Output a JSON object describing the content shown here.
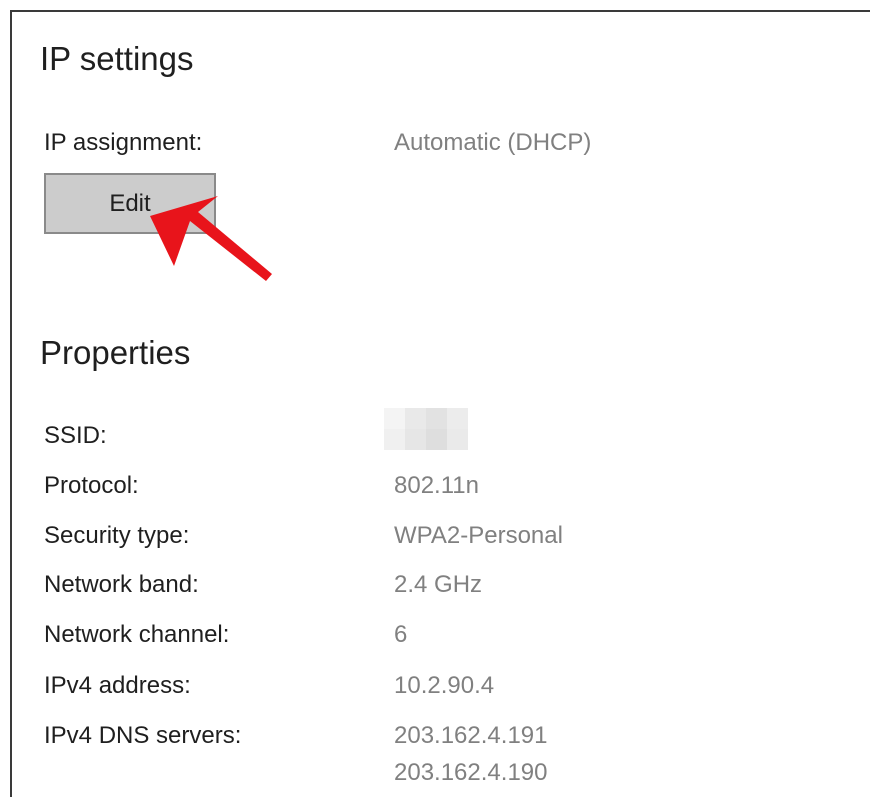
{
  "ip_settings": {
    "title": "IP settings",
    "assignment_label": "IP assignment:",
    "assignment_value": "Automatic (DHCP)",
    "edit_label": "Edit"
  },
  "properties": {
    "title": "Properties",
    "rows": [
      {
        "label": "SSID:",
        "value": ""
      },
      {
        "label": "Protocol:",
        "value": "802.11n"
      },
      {
        "label": "Security type:",
        "value": "WPA2-Personal"
      },
      {
        "label": "Network band:",
        "value": "2.4 GHz"
      },
      {
        "label": "Network channel:",
        "value": "6"
      },
      {
        "label": "IPv4 address:",
        "value": "10.2.90.4"
      },
      {
        "label": "IPv4 DNS servers:",
        "value": "203.162.4.191"
      },
      {
        "label": "",
        "value": "203.162.4.190"
      }
    ]
  },
  "annotation": {
    "arrow_icon": "red-arrow-icon",
    "arrow_color": "#e8141b"
  },
  "colors": {
    "label": "#1f1f1f",
    "value": "#808080",
    "button_bg": "#cccccc",
    "button_border": "#8a8a8a"
  }
}
